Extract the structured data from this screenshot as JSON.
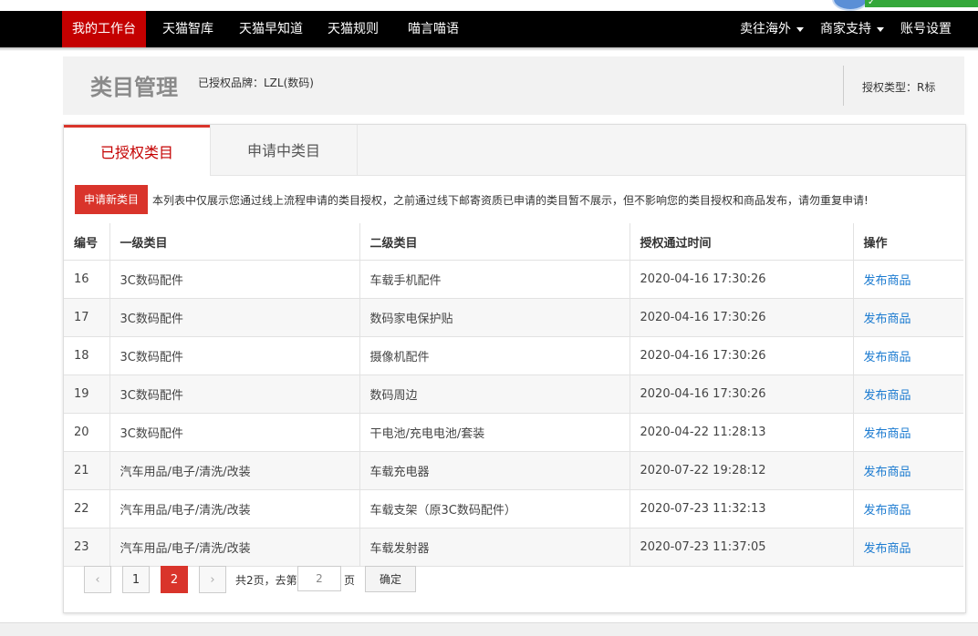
{
  "nav": {
    "items": [
      "我的工作台",
      "天猫智库",
      "天猫早知道",
      "天猫规则",
      "喵言喵语"
    ],
    "right": [
      "卖往海外",
      "商家支持",
      "账号设置"
    ]
  },
  "header": {
    "title": "类目管理",
    "brand": "已授权品牌：LZL(数码)",
    "type": "授权类型：R标"
  },
  "tabs": [
    "已授权类目",
    "申请中类目"
  ],
  "notice": {
    "button": "申请新类目",
    "text": "本列表中仅展示您通过线上流程申请的类目授权，之前通过线下邮寄资质已申请的类目暂不展示，但不影响您的类目授权和商品发布，请勿重复申请!"
  },
  "table": {
    "headers": [
      "编号",
      "一级类目",
      "二级类目",
      "授权通过时间",
      "操作"
    ],
    "rows": [
      [
        "16",
        "3C数码配件",
        "车载手机配件",
        "2020-04-16 17:30:26",
        "发布商品"
      ],
      [
        "17",
        "3C数码配件",
        "数码家电保护贴",
        "2020-04-16 17:30:26",
        "发布商品"
      ],
      [
        "18",
        "3C数码配件",
        "摄像机配件",
        "2020-04-16 17:30:26",
        "发布商品"
      ],
      [
        "19",
        "3C数码配件",
        "数码周边",
        "2020-04-16 17:30:26",
        "发布商品"
      ],
      [
        "20",
        "3C数码配件",
        "干电池/充电电池/套装",
        "2020-04-22 11:28:13",
        "发布商品"
      ],
      [
        "21",
        "汽车用品/电子/清洗/改装",
        "车载充电器",
        "2020-07-22 19:28:12",
        "发布商品"
      ],
      [
        "22",
        "汽车用品/电子/清洗/改装",
        "车载支架（原3C数码配件）",
        "2020-07-23 11:32:13",
        "发布商品"
      ],
      [
        "23",
        "汽车用品/电子/清洗/改装",
        "车载发射器",
        "2020-07-23 11:37:05",
        "发布商品"
      ]
    ]
  },
  "pagination": {
    "prev": "‹",
    "pages": [
      "1",
      "2"
    ],
    "current": "2",
    "next": "›",
    "total_text": "共2页，去第",
    "input_value": "2",
    "page_unit": "页",
    "confirm": "确定"
  }
}
